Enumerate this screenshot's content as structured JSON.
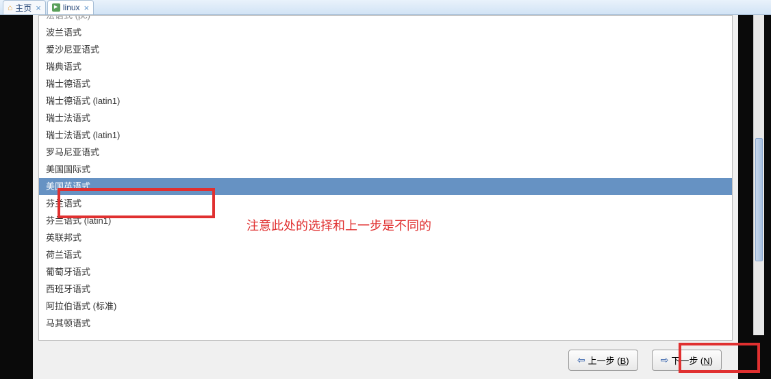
{
  "tabs": [
    {
      "label": "主页",
      "icon": "home"
    },
    {
      "label": "linux",
      "icon": "linux"
    }
  ],
  "list": {
    "items": [
      "波兰语式",
      "爱沙尼亚语式",
      "瑞典语式",
      "瑞士德语式",
      "瑞士德语式 (latin1)",
      "瑞士法语式",
      "瑞士法语式 (latin1)",
      "罗马尼亚语式",
      "美国国际式",
      "美国英语式",
      "芬兰语式",
      "芬兰语式 (latin1)",
      "英联邦式",
      "荷兰语式",
      "葡萄牙语式",
      "西班牙语式",
      "阿拉伯语式 (标准)",
      "马其顿语式"
    ],
    "selected_index": 9,
    "cut_item": "法语式 (pc)"
  },
  "annotation": "注意此处的选择和上一步是不同的",
  "buttons": {
    "back_prefix": "上一步 (",
    "back_key": "B",
    "back_suffix": ")",
    "next_prefix": "下一步 (",
    "next_key": "N",
    "next_suffix": ")"
  }
}
